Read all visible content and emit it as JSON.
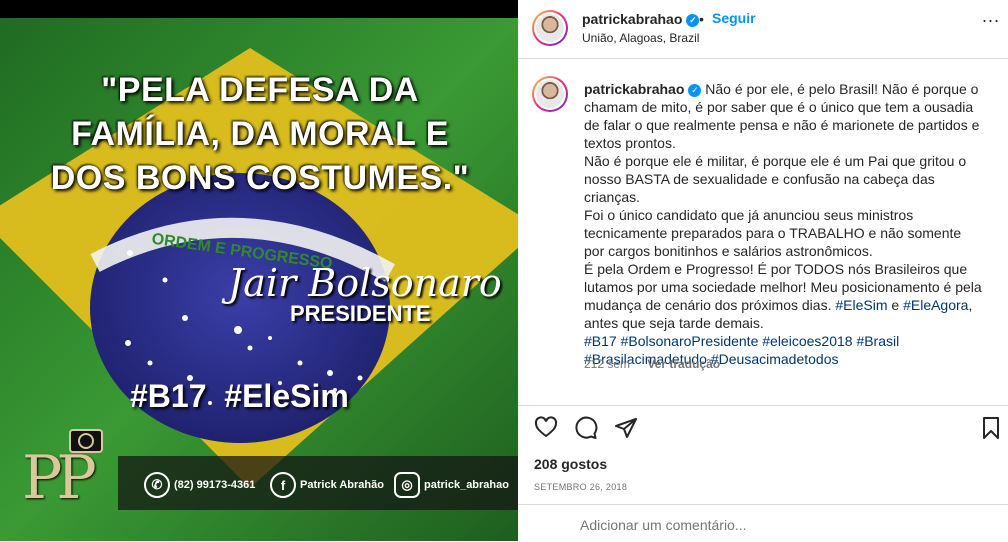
{
  "post": {
    "image": {
      "quote": "\"PELA DEFESA DA FAMÍLIA, DA MORAL E DOS BONS COSTUMES.\"",
      "signature": "Jair Bolsonaro",
      "title": "PRESIDENTE",
      "hashtags": "#B17  #EleSim",
      "phone": "(82) 99173-4361",
      "facebook": "Patrick Abrahão",
      "instagram": "patrick_abrahao",
      "logo": "PP",
      "flag_motto": "ORDEM E PROGRESSO",
      "colors": {
        "green": "#2f8a2e",
        "yellow": "#e8c51f",
        "blue": "#2a2f8f"
      }
    },
    "header": {
      "username": "patrickabrahao",
      "follow": "Seguir",
      "separator": "•",
      "location": "União, Alagoas, Brazil",
      "more": "..."
    },
    "caption": {
      "username": "patrickabrahao",
      "text1": "Não é por ele, é pelo Brasil! Não é porque o chamam de mito, é por saber que é o único que tem a ousadia de falar o que realmente pensa e não é marionete de partidos e textos prontos.",
      "text2": "Não é porque ele é militar, é porque ele é um Pai que gritou o nosso BASTA de sexualidade e confusão na cabeça das crianças.",
      "text3": "Foi o único candidato que já anunciou seus ministros tecnicamente preparados para o TRABALHO e não somente por cargos bonitinhos e salários astronômicos.",
      "text4a": "É pela Ordem e Progresso! É por TODOS nós Brasileiros que lutamos por uma sociedade melhor! Meu posicionamento é pela mudança de cenário dos próximos dias. ",
      "tag_a": "#EleSim",
      "text4b": " e ",
      "tag_b": "#EleAgora",
      "text4c": ", antes que seja tarde demais.",
      "tags": [
        "#B17",
        "#BolsonaroPresidente",
        "#eleicoes2018",
        "#Brasil",
        "#Brasilacimadetudo",
        "#Deusacimadetodos"
      ],
      "time": "212 sem",
      "translate": "Ver tradução"
    },
    "likes": "208 gostos",
    "date": "SETEMBRO 26, 2018",
    "comment_placeholder": "Adicionar um comentário..."
  }
}
